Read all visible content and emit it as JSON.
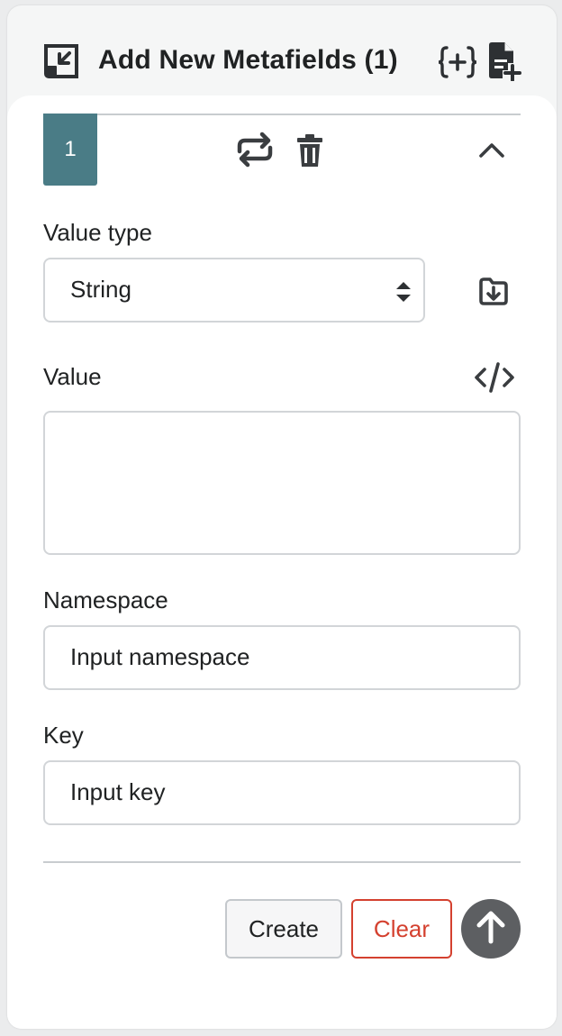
{
  "header": {
    "title": "Add New Metafields (1)",
    "icons": [
      "collapse-panel-icon",
      "json-braces-add-icon",
      "add-file-icon"
    ]
  },
  "item": {
    "number": "1",
    "icons": [
      "repeat-icon",
      "trash-icon",
      "chevron-up-icon"
    ]
  },
  "fields": {
    "value_type": {
      "label": "Value type",
      "selected": "String"
    },
    "value": {
      "label": "Value",
      "content": ""
    },
    "namespace": {
      "label": "Namespace",
      "placeholder": "Input namespace"
    },
    "key": {
      "label": "Key",
      "placeholder": "Input key"
    }
  },
  "actions": {
    "create_label": "Create",
    "clear_label": "Clear"
  },
  "colors": {
    "badge": "#4a7c86",
    "clear": "#d4412f",
    "scroll_top_button": "#5d5f62"
  }
}
